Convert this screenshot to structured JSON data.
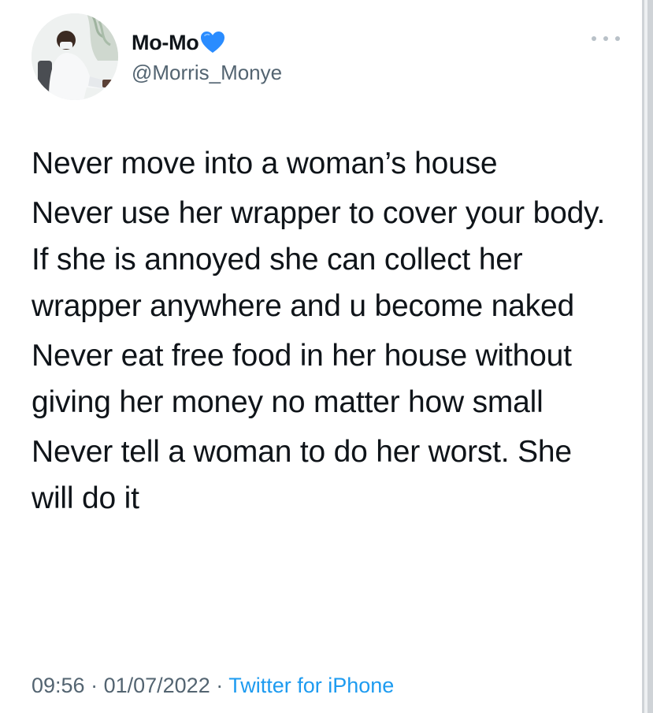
{
  "user": {
    "display_name": "Mo-Mo",
    "name_emoji": "blue-heart-icon",
    "handle": "@Morris_Monye",
    "avatar": "profile-photo"
  },
  "tweet": {
    "paragraphs": [
      "Never move into a woman’s house",
      "Never use her wrapper to cover your body. If she is annoyed she can collect her wrapper anywhere and u become naked",
      "Never eat free food in her house without giving her money no matter how small",
      "Never tell a woman to do her worst. She will do it"
    ],
    "time": "09:56",
    "separator": " · ",
    "date": "01/07/2022",
    "source": "Twitter for iPhone"
  },
  "icons": {
    "more": "more-horizontal-icon"
  },
  "colors": {
    "text": "#0f1419",
    "secondary": "#536471",
    "link": "#1d9bf0",
    "heart": "#2a8cff"
  }
}
